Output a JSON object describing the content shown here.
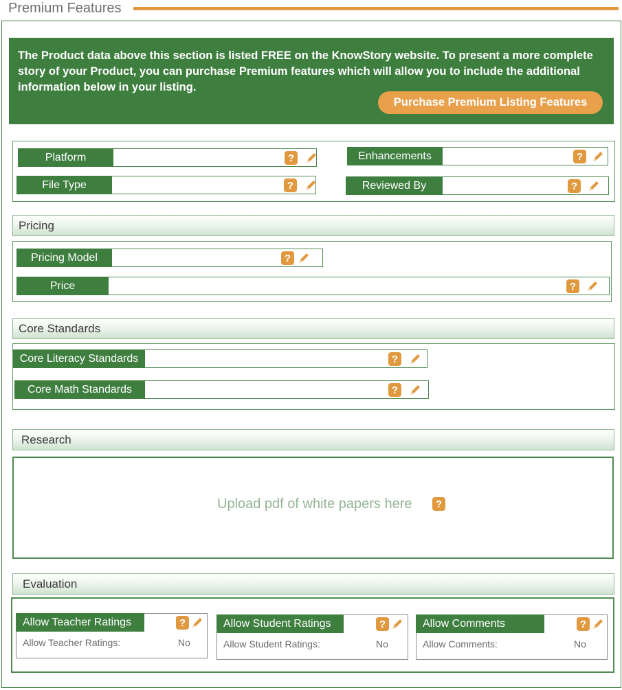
{
  "header": {
    "title": "Premium Features"
  },
  "banner": {
    "text": "The Product data above this section is listed FREE on the KnowStory website.  To present a more complete story of your Product, you can purchase Premium features which will allow you to include the additional information below in your listing.",
    "button_label": "Purchase Premium Listing Features"
  },
  "basic_fields": {
    "platform": "Platform",
    "enhancements": "Enhancements",
    "file_type": "File Type",
    "reviewed_by": "Reviewed By"
  },
  "pricing": {
    "title": "Pricing",
    "pricing_model": "Pricing Model",
    "price": "Price"
  },
  "core_standards": {
    "title": "Core Standards",
    "literacy": "Core Literacy Standards",
    "math": "Core Math Standards"
  },
  "research": {
    "title": "Research",
    "upload_text": "Upload pdf of white papers here"
  },
  "evaluation": {
    "title": "Evaluation",
    "cards": [
      {
        "label": "Allow Teacher Ratings",
        "key": "Allow Teacher Ratings:",
        "value": "No"
      },
      {
        "label": "Allow Student Ratings",
        "key": "Allow Student Ratings:",
        "value": "No"
      },
      {
        "label": "Allow Comments",
        "key": "Allow Comments:",
        "value": "No"
      }
    ]
  },
  "icons": {
    "help": "question-mark-icon",
    "edit": "pencil-icon",
    "help_glyph": "?"
  },
  "colors": {
    "green": "#3e7e3f",
    "orange": "#e0993f",
    "light_green_text": "#94b594"
  }
}
